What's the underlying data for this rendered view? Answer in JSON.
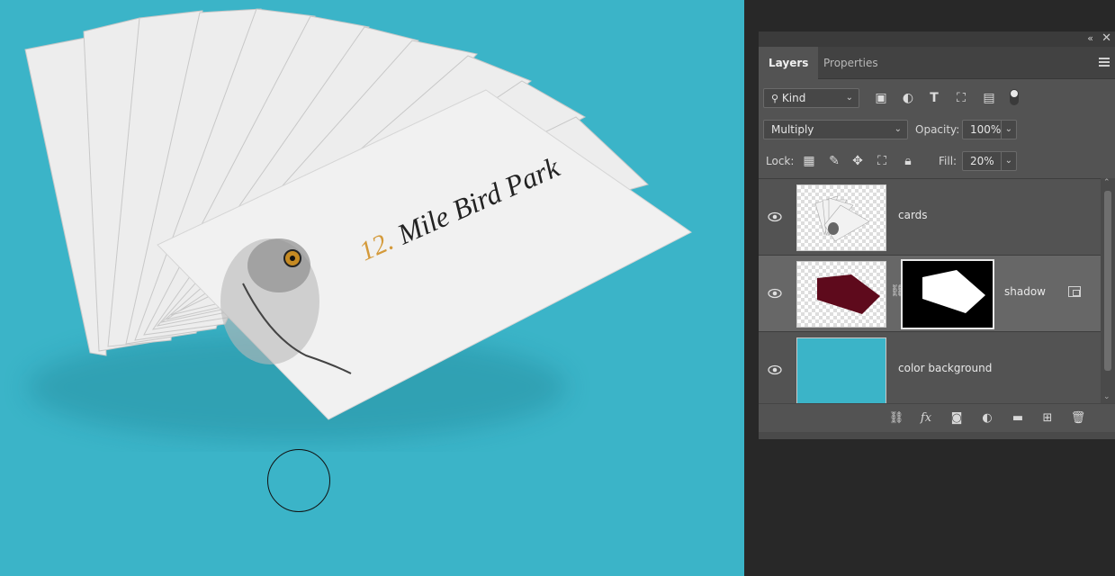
{
  "canvas": {
    "background_color": "#3bb4c8",
    "card_text_number": "12.",
    "card_text_title": "Mile Bird Park"
  },
  "panel": {
    "tabs": [
      {
        "label": "Layers",
        "active": true
      },
      {
        "label": "Properties",
        "active": false
      }
    ],
    "filter": {
      "kind_label": "Kind"
    },
    "blend_mode": "Multiply",
    "opacity_label": "Opacity:",
    "opacity_value": "100%",
    "lock_label": "Lock:",
    "fill_label": "Fill:",
    "fill_value": "20%",
    "layers": [
      {
        "name": "cards",
        "visible": true,
        "selected": false
      },
      {
        "name": "shadow",
        "visible": true,
        "selected": true,
        "mask_color": "#5e0a1c"
      },
      {
        "name": "color background",
        "visible": true,
        "selected": false,
        "color": "#3bb4c8"
      }
    ]
  }
}
